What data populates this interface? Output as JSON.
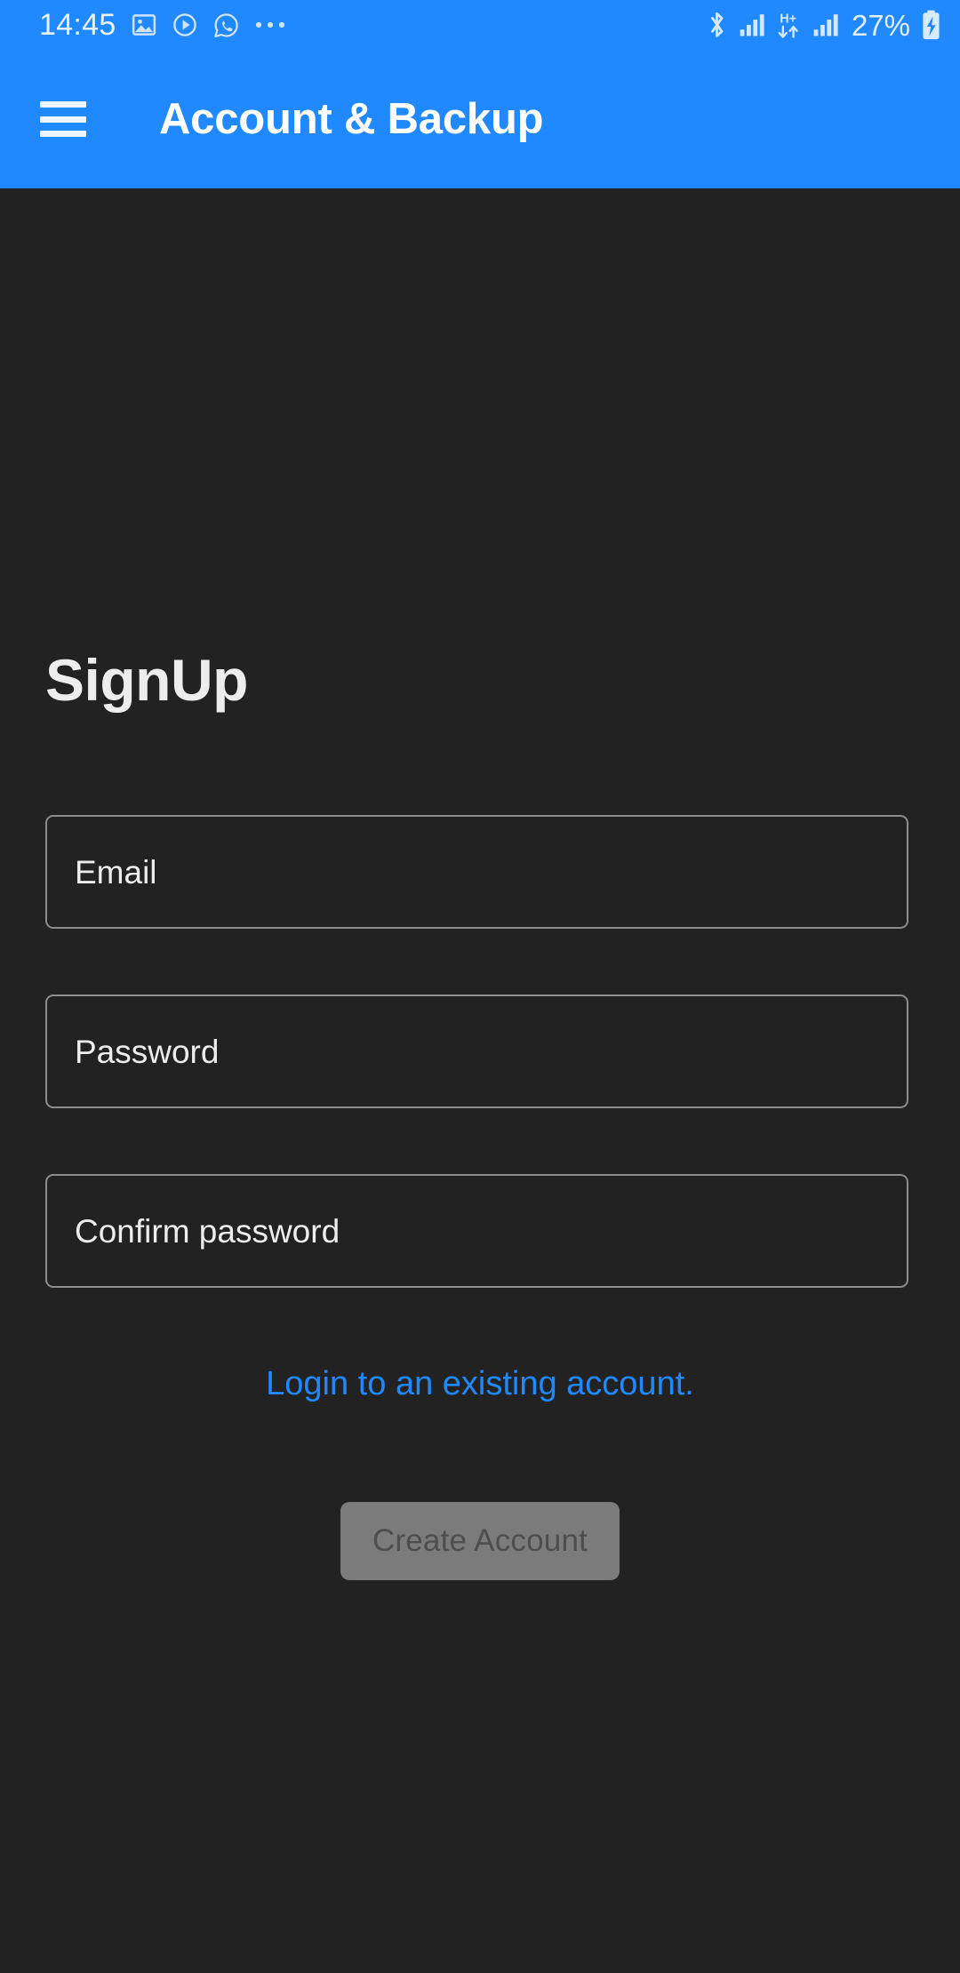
{
  "status_bar": {
    "time": "14:45",
    "battery_percent": "27%",
    "left_icons": [
      {
        "name": "photo-icon",
        "label": "Photos"
      },
      {
        "name": "play-circle-icon",
        "label": "Media player"
      },
      {
        "name": "whatsapp-icon",
        "label": "WhatsApp"
      },
      {
        "name": "more-notifications-icon",
        "label": "More notifications"
      }
    ],
    "right_icons": [
      {
        "name": "bluetooth-icon",
        "label": "Bluetooth"
      },
      {
        "name": "signal-bars-icon-1",
        "label": "Signal strength SIM 1"
      },
      {
        "name": "hplus-data-icon",
        "label": "H+",
        "text": "H+"
      },
      {
        "name": "signal-bars-icon-2",
        "label": "Signal strength SIM 2"
      },
      {
        "name": "battery-charging-icon",
        "label": "Battery charging"
      }
    ],
    "colors": {
      "background": "#2089FF",
      "foreground": "#E8F2FF"
    }
  },
  "app_bar": {
    "menu_icon": "hamburger-menu-icon",
    "title": "Account & Backup",
    "background": "#2089FF",
    "title_color": "#FFFFFF"
  },
  "page": {
    "background": "#222222",
    "heading": "SignUp"
  },
  "form": {
    "fields": [
      {
        "name": "email-field",
        "placeholder": "Email",
        "value": "",
        "type": "email"
      },
      {
        "name": "password-field",
        "placeholder": "Password",
        "value": "",
        "type": "password"
      },
      {
        "name": "confirm-password-field",
        "placeholder": "Confirm password",
        "value": "",
        "type": "password"
      }
    ],
    "login_link": "Login to an existing account.",
    "login_link_color": "#2089FF",
    "submit_label": "Create Account",
    "submit_enabled": false,
    "submit_background": "#7B7B7B",
    "submit_text_color": "#4E4E4E",
    "field_border_color": "#8D8D8D"
  }
}
